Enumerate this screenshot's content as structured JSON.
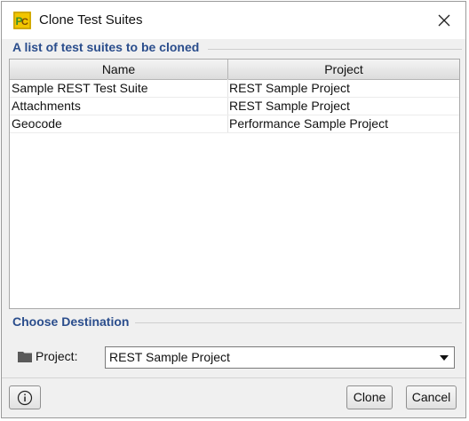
{
  "window": {
    "title": "Clone Test Suites"
  },
  "suites_section": {
    "legend": "A list of test suites to be cloned",
    "columns": {
      "name": "Name",
      "project": "Project"
    },
    "rows": [
      {
        "name": "Sample REST Test Suite",
        "project": "REST Sample Project"
      },
      {
        "name": "Attachments",
        "project": "REST Sample Project"
      },
      {
        "name": "Geocode",
        "project": "Performance Sample Project"
      }
    ]
  },
  "destination_section": {
    "legend": "Choose Destination",
    "project_label": "Project:",
    "project_selected": "REST Sample Project"
  },
  "buttons": {
    "clone": "Clone",
    "cancel": "Cancel"
  },
  "colors": {
    "legend": "#2a4d8c",
    "window_bg": "#f0f0f0",
    "app_icon_yellow": "#f2c500",
    "app_icon_green": "#3a8f2a"
  },
  "icons": {
    "app": "soapui-icon",
    "close": "close-icon",
    "folder": "folder-icon",
    "info": "info-icon",
    "dropdown": "chevron-down-icon"
  }
}
